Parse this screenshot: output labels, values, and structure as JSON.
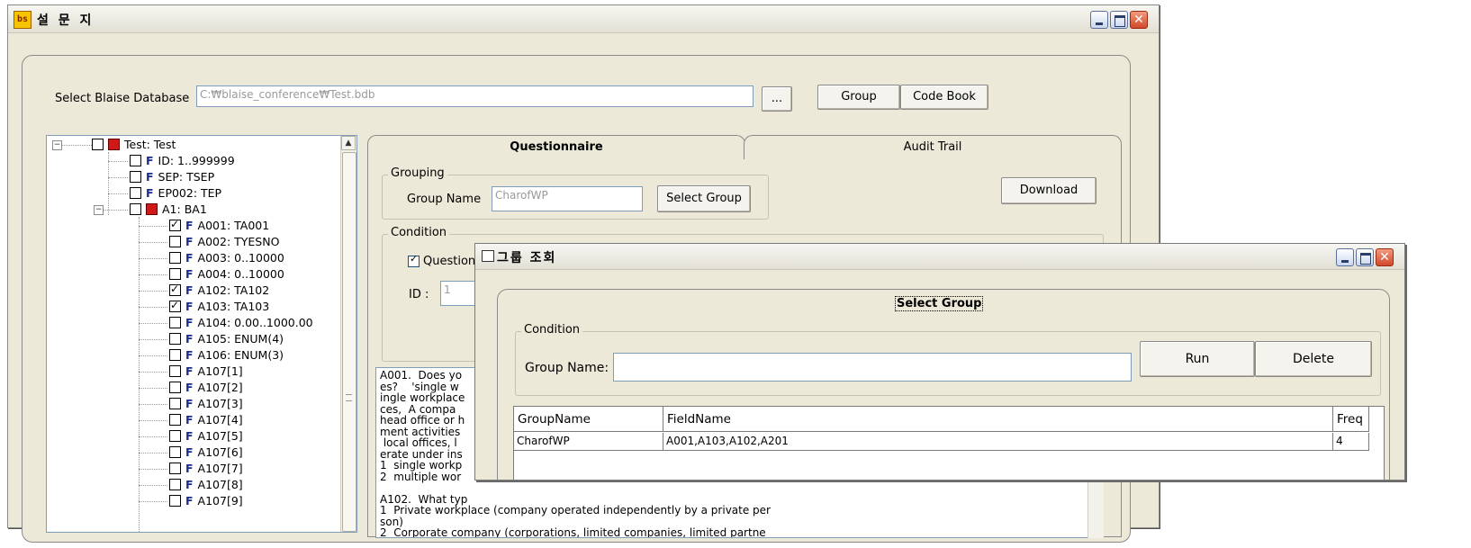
{
  "main_window": {
    "icon_text": "bs",
    "title": "설 문 지",
    "database_label": "Select Blaise Database",
    "database_path": "C:₩blaise_conference₩Test.bdb",
    "browse_label": "...",
    "group_button": "Group",
    "codebook_button": "Code Book"
  },
  "tree": {
    "root": "Test: Test",
    "items": [
      {
        "label": "ID: 1..999999",
        "checked": false
      },
      {
        "label": "SEP: TSEP",
        "checked": false
      },
      {
        "label": "EP002: TEP",
        "checked": false
      }
    ],
    "block": "A1: BA1",
    "block_items": [
      {
        "label": "A001: TA001",
        "checked": true
      },
      {
        "label": "A002: TYESNO",
        "checked": false
      },
      {
        "label": "A003: 0..10000",
        "checked": false
      },
      {
        "label": "A004: 0..10000",
        "checked": false
      },
      {
        "label": "A102: TA102",
        "checked": true
      },
      {
        "label": "A103: TA103",
        "checked": true
      },
      {
        "label": "A104: 0.00..1000.00",
        "checked": false
      },
      {
        "label": "A105: ENUM(4)",
        "checked": false
      },
      {
        "label": "A106: ENUM(3)",
        "checked": false
      },
      {
        "label": "A107[1]",
        "checked": false
      },
      {
        "label": "A107[2]",
        "checked": false
      },
      {
        "label": "A107[3]",
        "checked": false
      },
      {
        "label": "A107[4]",
        "checked": false
      },
      {
        "label": "A107[5]",
        "checked": false
      },
      {
        "label": "A107[6]",
        "checked": false
      },
      {
        "label": "A107[7]",
        "checked": false
      },
      {
        "label": "A107[8]",
        "checked": false
      },
      {
        "label": "A107[9]",
        "checked": false
      }
    ],
    "field_tag": "F"
  },
  "tabs": [
    "Questionnaire",
    "Audit Trail"
  ],
  "questionnaire": {
    "grouping_legend": "Grouping",
    "group_name_label": "Group Name",
    "group_name_value": "CharofWP",
    "select_group_button": "Select Group",
    "download_button": "Download",
    "condition_legend": "Condition",
    "question_check_label": "Question",
    "id_label": "ID :",
    "id_value": "1",
    "text": "A001.  Does yo\nes?    'single w\ningle workplace\nces,  A compa\nhead office or h\nment activities\n local offices, l\nerate under ins\n1  single workp\n2  multiple wor\n\nA102.  What typ\n1  Private workplace (company operated independently by a private per\nson)\n2  Corporate company (corporations, limited companies, limited partne\nrships, general partnerships, foreign companies)"
  },
  "dialog": {
    "title": "그룹 조회",
    "heading": "Select Group",
    "condition_legend": "Condition",
    "group_name_label": "Group Name:",
    "run_button": "Run",
    "delete_button": "Delete",
    "columns": [
      "GroupName",
      "FieldName",
      "Freq"
    ],
    "rows": [
      {
        "GroupName": "CharofWP",
        "FieldName": "A001,A103,A102,A201",
        "Freq": "4"
      }
    ]
  }
}
